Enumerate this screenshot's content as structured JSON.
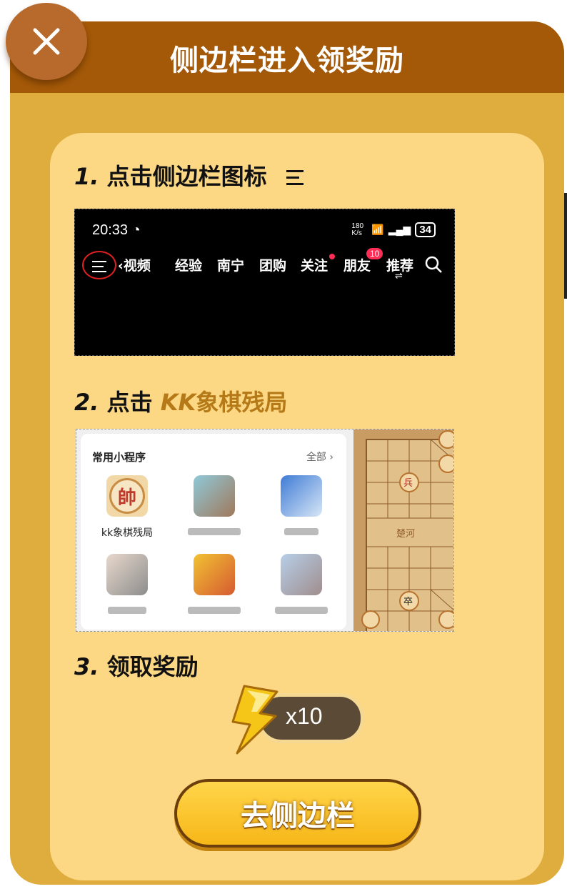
{
  "dialog": {
    "title": "侧边栏进入领奖励",
    "close_icon": "close-icon"
  },
  "steps": [
    {
      "num": "1.",
      "text": "点击侧边栏图标"
    },
    {
      "num": "2.",
      "prefix": "点击 ",
      "highlight_latin": "KK",
      "highlight_cjk": "象棋残局"
    },
    {
      "num": "3.",
      "text": "领取奖励"
    }
  ],
  "screenshot1": {
    "time": "20:33",
    "speed": "180 K/s",
    "battery": "34",
    "nav_items": [
      "视频",
      "经验",
      "南宁",
      "团购",
      "关注",
      "朋友",
      "推荐"
    ],
    "friends_badge": "10"
  },
  "screenshot2": {
    "title": "常用小程序",
    "all_label": "全部",
    "apps": [
      {
        "label": "kk象棋残局",
        "icon_char": "帥"
      }
    ],
    "board_label": "楚河"
  },
  "reward": {
    "count": "x10",
    "icon": "lightning-bolt-icon"
  },
  "go_button": {
    "label": "去侧边栏"
  },
  "colors": {
    "header": "#a35907",
    "frame": "#dfad3e",
    "panel": "#fdd884",
    "highlight": "#b57a17",
    "button": "#f7b718"
  }
}
